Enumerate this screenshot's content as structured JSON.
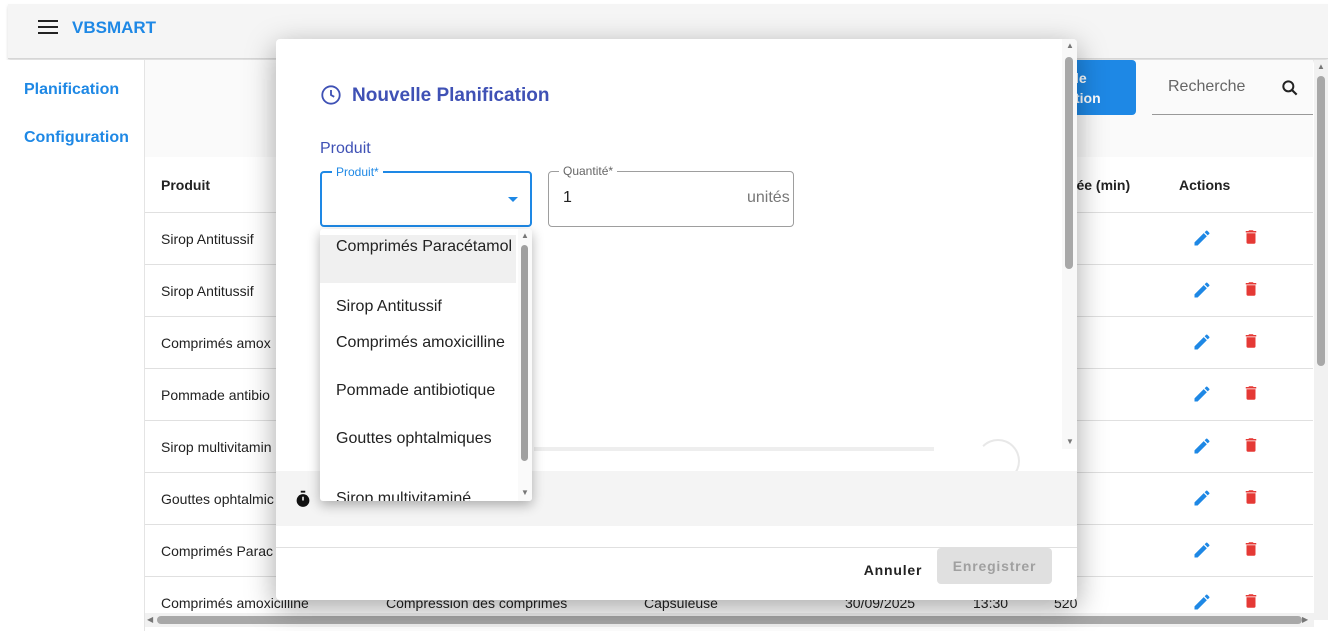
{
  "app": {
    "title": "VBSMART"
  },
  "sidebar": {
    "items": [
      {
        "label": "Planification"
      },
      {
        "label": "Configuration"
      }
    ]
  },
  "toolbar": {
    "add_label_partial": "le\ntion",
    "search_placeholder": "Recherche"
  },
  "table": {
    "headers": {
      "produit": "Produit",
      "duree": "rée (min)",
      "actions": "Actions"
    },
    "rows": [
      {
        "produit": "Sirop Antitussif",
        "duree": ""
      },
      {
        "produit": "Sirop Antitussif",
        "duree": ""
      },
      {
        "produit": "Comprimés amox",
        "duree": ""
      },
      {
        "produit": "Pommade antibio",
        "duree": ")"
      },
      {
        "produit": "Sirop multivitamin",
        "duree": ""
      },
      {
        "produit": "Gouttes ophtalmic",
        "duree": ")"
      },
      {
        "produit": "Comprimés Parac",
        "duree": ""
      },
      {
        "produit": "Comprimés amoxicilline",
        "operation": "Compression des comprimés",
        "machine": "Capsuleuse",
        "date": "30/09/2025",
        "heure": "13:30",
        "duree": "520"
      }
    ]
  },
  "dialog": {
    "title": "Nouvelle Planification",
    "section_label": "Produit",
    "produit_field": {
      "label": "Produit*",
      "value": ""
    },
    "quantite_field": {
      "label": "Quantité*",
      "value": "1",
      "unit": "unités"
    },
    "cancel_label": "Annuler",
    "save_label": "Enregistrer"
  },
  "dropdown": {
    "options": [
      {
        "label": "Comprimés Paracétamol"
      },
      {
        "label": "Sirop Antitussif"
      },
      {
        "label": "Comprimés amoxicilline"
      },
      {
        "label": "Pommade antibiotique"
      },
      {
        "label": "Gouttes ophtalmiques"
      },
      {
        "label": "Sirop multivitaminé"
      }
    ]
  },
  "colors": {
    "primary": "#1e88e5",
    "dialog_accent": "#3f51b5",
    "delete": "#e53935"
  },
  "icons": [
    "menu-icon",
    "search-icon",
    "edit-icon",
    "delete-icon",
    "clock-icon",
    "timer-icon",
    "chevron-down-icon"
  ]
}
